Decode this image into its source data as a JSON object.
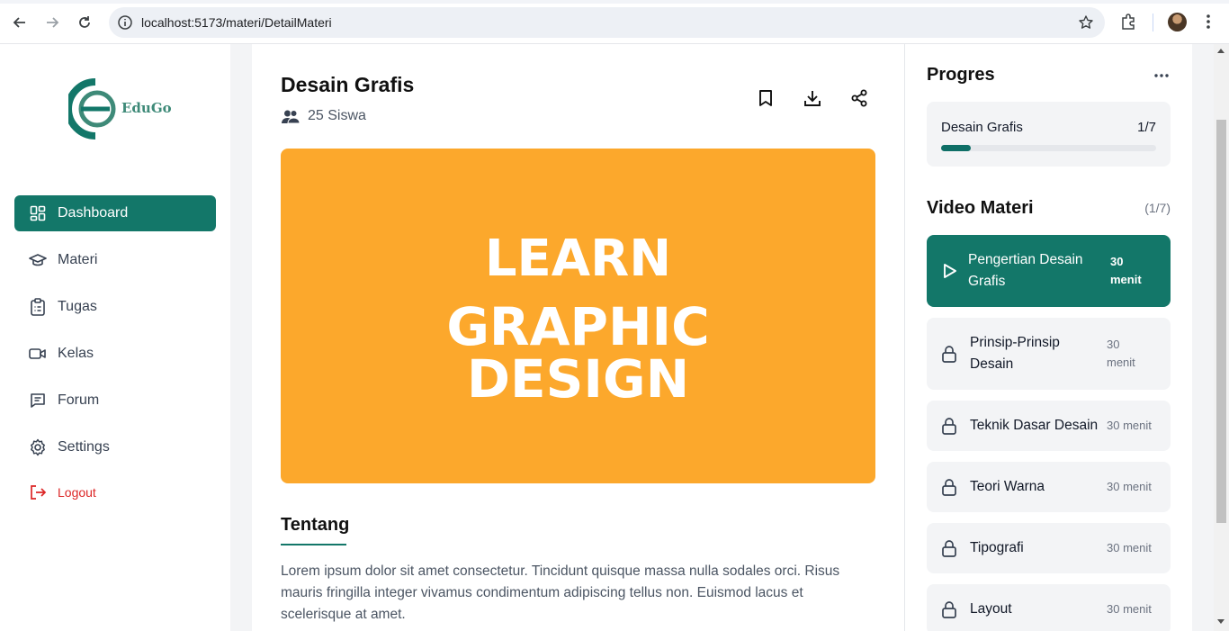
{
  "browser": {
    "url": "localhost:5173/materi/DetailMateri"
  },
  "sidebar": {
    "logo_text": "EduGo",
    "items": [
      {
        "label": "Dashboard",
        "icon": "dashboard-icon",
        "active": true
      },
      {
        "label": "Materi",
        "icon": "graduation-cap-icon"
      },
      {
        "label": "Tugas",
        "icon": "clipboard-icon"
      },
      {
        "label": "Kelas",
        "icon": "video-icon"
      },
      {
        "label": "Forum",
        "icon": "chat-icon"
      },
      {
        "label": "Settings",
        "icon": "gear-icon"
      }
    ],
    "logout_label": "Logout"
  },
  "course": {
    "title": "Desain Grafis",
    "students": "25 Siswa",
    "hero": {
      "line1": "LEARN",
      "line2": "GRAPHIC",
      "line3": "DESIGN",
      "background": "#fca82c"
    },
    "about_title": "Tentang",
    "about_text": "Lorem ipsum dolor sit amet consectetur. Tincidunt quisque massa nulla sodales orci. Risus mauris fringilla integer vivamus condimentum adipiscing tellus non. Euismod lacus et scelerisque at amet."
  },
  "progress": {
    "title": "Progres",
    "course_name": "Desain Grafis",
    "count": "1/7",
    "fraction": 0.14
  },
  "videos": {
    "title": "Video Materi",
    "count": "(1/7)",
    "items": [
      {
        "label": "Pengertian Desain Grafis",
        "duration": "30 menit",
        "state": "playing"
      },
      {
        "label": "Prinsip-Prinsip Desain",
        "duration": "30 menit",
        "state": "locked"
      },
      {
        "label": "Teknik Dasar Desain",
        "duration": "30 menit",
        "state": "locked"
      },
      {
        "label": "Teori Warna",
        "duration": "30 menit",
        "state": "locked"
      },
      {
        "label": "Tipografi",
        "duration": "30 menit",
        "state": "locked"
      },
      {
        "label": "Layout",
        "duration": "30 menit",
        "state": "locked"
      }
    ]
  },
  "colors": {
    "brand": "#137769",
    "danger": "#dc2626"
  }
}
